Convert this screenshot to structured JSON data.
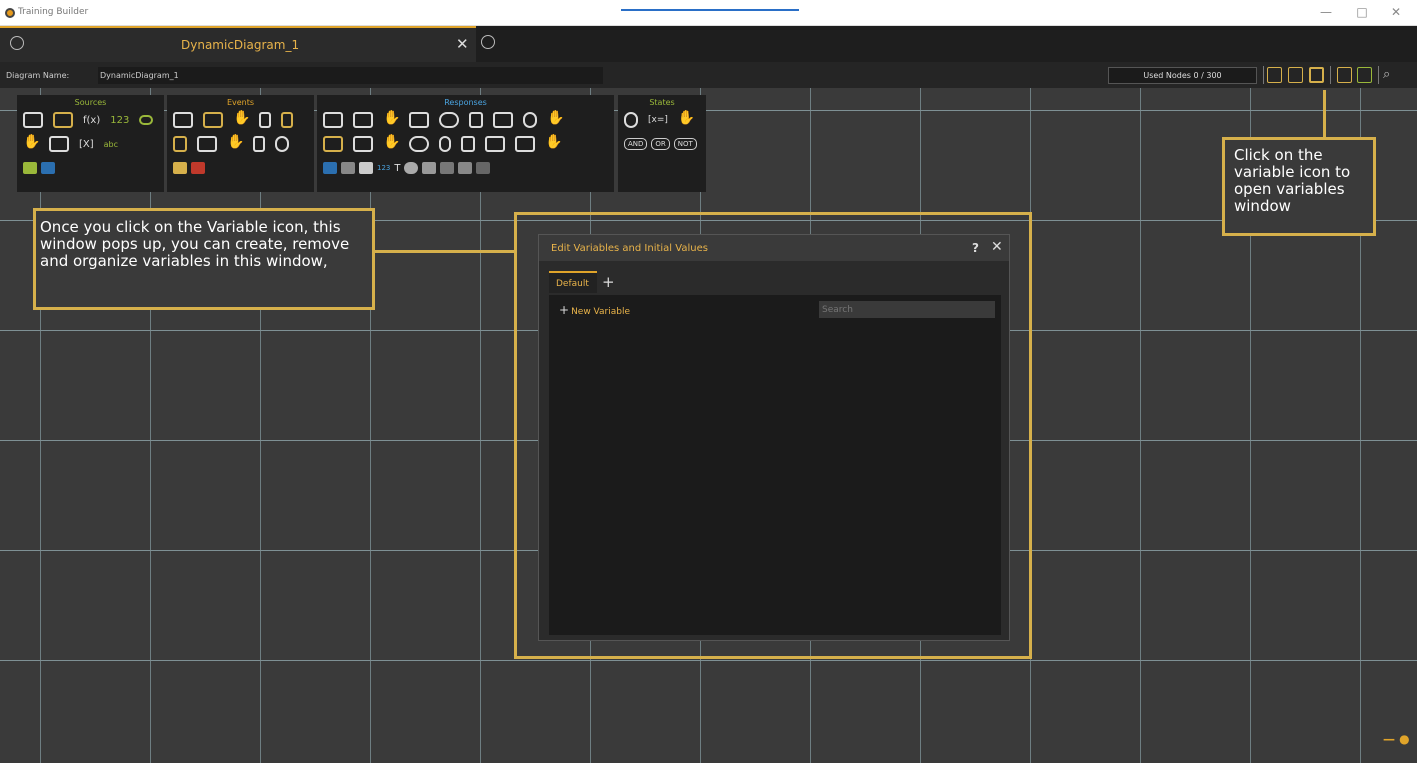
{
  "window": {
    "title": "Training Builder",
    "controls": [
      "—",
      "□",
      "✕"
    ]
  },
  "tabs": {
    "active_label": "DynamicDiagram_1",
    "close": "✕"
  },
  "diagram": {
    "name_label": "Diagram Name:",
    "name_value": "DynamicDiagram_1",
    "used_nodes": "Used Nodes 0 / 300"
  },
  "palette": {
    "sources": {
      "title": "Sources",
      "fx": "f(x)",
      "num": "123",
      "var": "[X]",
      "abc": "abc"
    },
    "events": {
      "title": "Events"
    },
    "responses": {
      "title": "Responses",
      "num": "123",
      "text": "T"
    },
    "states": {
      "title": "States",
      "varcheck": "[x=]",
      "and": "AND",
      "or": "OR",
      "not": "NOT"
    }
  },
  "callouts": {
    "left": "Once you click on the Variable icon, this window pops up, you can create, remove and organize variables in this window,",
    "right": "Click on the variable icon to open variables window"
  },
  "popup": {
    "title": "Edit Variables and Initial Values",
    "help": "?",
    "close": "✕",
    "tab_label": "Default",
    "add_tab": "+",
    "new_variable": "New Variable",
    "search_placeholder": "Search"
  },
  "colors": {
    "accent": "#d6b04b",
    "tab_accent": "#e0a42a",
    "green": "#9ab83a",
    "canvas": "#3a3a3a"
  },
  "icons": [
    "app-logo-icon",
    "home-icon",
    "new-tab-icon",
    "add-node-icon",
    "subdiagram-icon",
    "variable-icon",
    "notes-icon",
    "table-icon",
    "search-icon",
    "help-icon"
  ]
}
